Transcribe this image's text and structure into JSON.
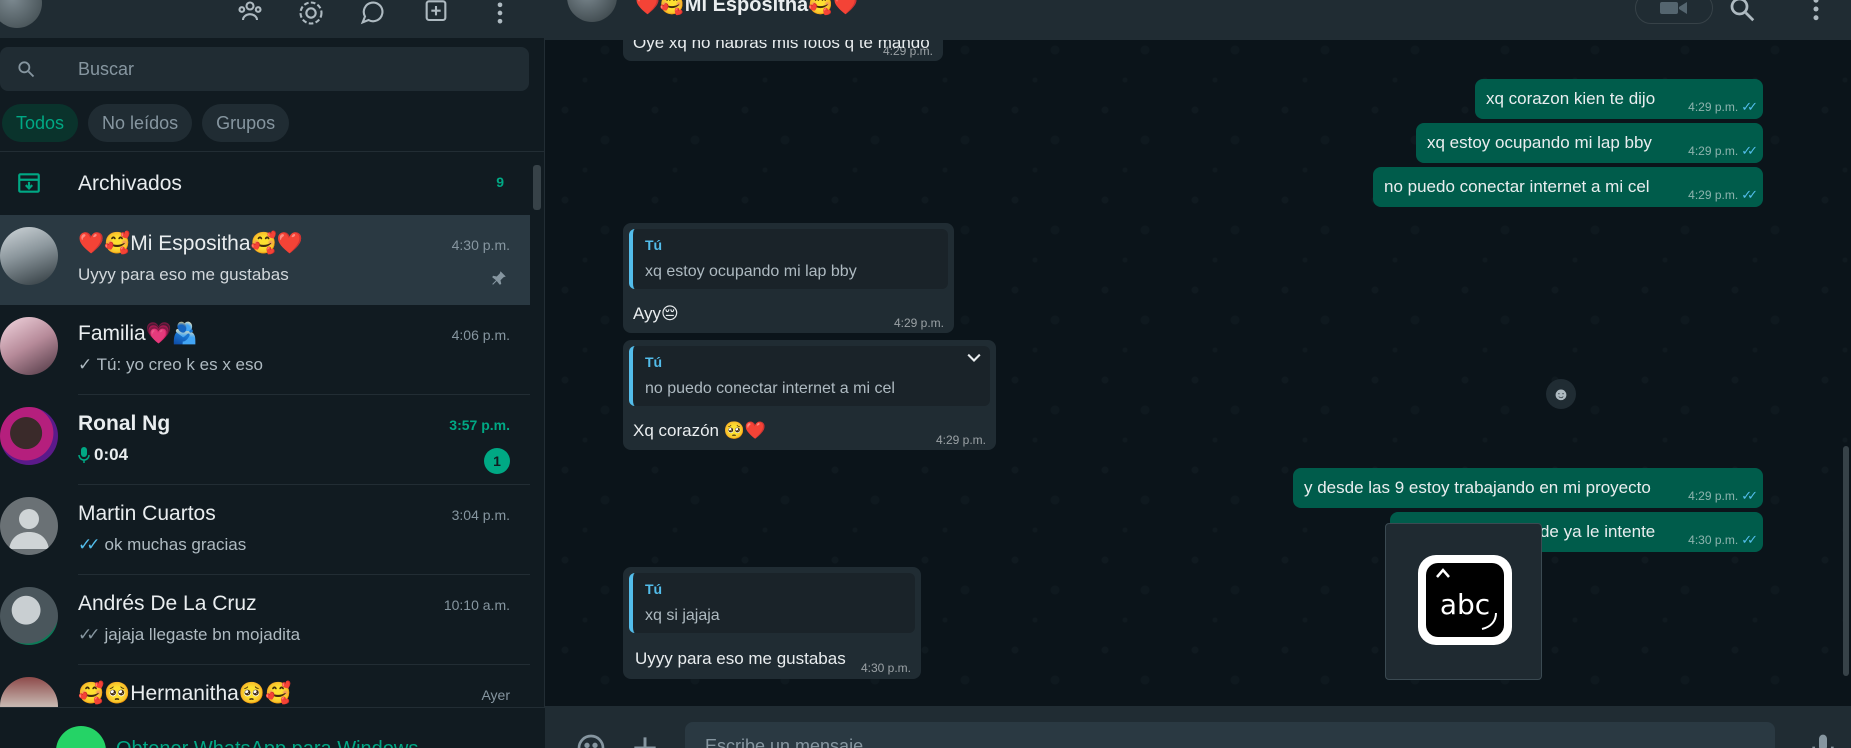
{
  "search": {
    "placeholder": "Buscar"
  },
  "filters": [
    "Todos",
    "No leídos",
    "Grupos"
  ],
  "archived": {
    "label": "Archivados",
    "count": "9"
  },
  "chats": [
    {
      "name": "❤️🥰Mi Espositha🥰❤️",
      "time": "4:30 p.m.",
      "preview": "Uyyy para eso me gustabas",
      "pinned": true,
      "selected": true
    },
    {
      "name": "Familia💗🫂",
      "time": "4:06 p.m.",
      "preview": "✓ Tú: yo creo k es x eso"
    },
    {
      "name": "Ronal Ng",
      "time": "3:57 p.m.",
      "preview": "0:04",
      "unread": "1"
    },
    {
      "name": "Martin Cuartos",
      "time": "3:04 p.m.",
      "preview": "ok muchas gracias"
    },
    {
      "name": "Andrés De La Cruz",
      "time": "10:10 a.m.",
      "preview": "jajaja llegaste bn mojadita"
    },
    {
      "name": "🥰🥺Hermanitha🥺🥰",
      "time": "Ayer",
      "preview": ""
    }
  ],
  "get_app": "Obtener WhatsApp para Windows",
  "chat": {
    "contact_name": "❤️🥰Mi Espositha🥰❤️",
    "messages": [
      {
        "dir": "in",
        "text": "Oye xq no habrás mis fotos q te mando",
        "time": "4:29 p.m."
      },
      {
        "dir": "out",
        "text": "xq corazon kien te dijo",
        "time": "4:29 p.m."
      },
      {
        "dir": "out",
        "text": "xq estoy ocupando mi lap bby",
        "time": "4:29 p.m."
      },
      {
        "dir": "out",
        "text": "no puedo conectar internet a mi cel",
        "time": "4:29 p.m."
      },
      {
        "dir": "in",
        "quote_author": "Tú",
        "quote": "xq estoy ocupando mi lap bby",
        "text": "Ayy😔",
        "time": "4:29 p.m."
      },
      {
        "dir": "in",
        "quote_author": "Tú",
        "quote": "no puedo conectar internet a mi cel",
        "text": "Xq corazón 🥺❤️",
        "time": "4:29 p.m."
      },
      {
        "dir": "out",
        "text": "y desde las 9 estoy trabajando en mi proyecto",
        "time": "4:29 p.m."
      },
      {
        "dir": "out",
        "text": "nose xq no se puede ya le intente",
        "time": "4:30 p.m."
      },
      {
        "dir": "in",
        "quote_author": "Tú",
        "quote": "xq si jajaja",
        "text": "Uyyy para eso me gustabas",
        "time": "4:30 p.m."
      }
    ],
    "composer_placeholder": "Escribe un mensaje",
    "overlay_text": "abc"
  },
  "colors": {
    "accent": "#00a884",
    "outgoing": "#005c4b",
    "incoming": "#202c33",
    "read_ticks": "#53bdeb"
  }
}
